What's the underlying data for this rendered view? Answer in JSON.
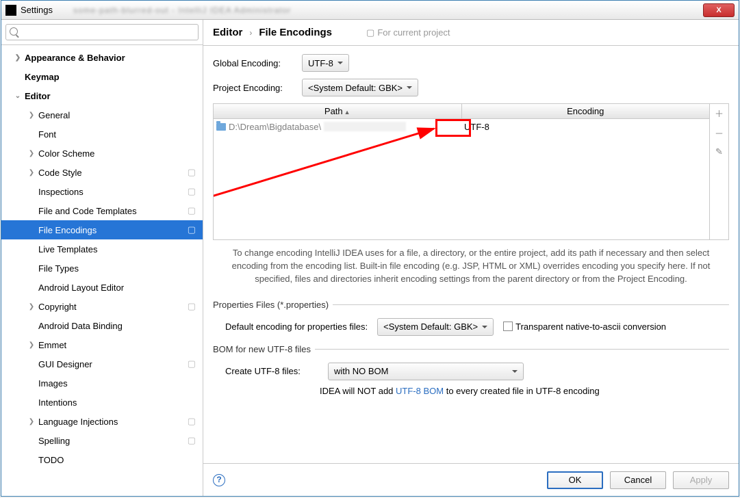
{
  "window": {
    "title": "Settings",
    "title_blur": "some-path-blurred-out  -  IntelliJ IDEA Administrator"
  },
  "search": {
    "placeholder": ""
  },
  "tree": [
    {
      "label": "Appearance & Behavior",
      "lvl": 0,
      "chev": ">",
      "bold": true
    },
    {
      "label": "Keymap",
      "lvl": 0,
      "chev": "",
      "bold": true
    },
    {
      "label": "Editor",
      "lvl": 0,
      "chev": "v",
      "bold": true
    },
    {
      "label": "General",
      "lvl": 1,
      "chev": ">"
    },
    {
      "label": "Font",
      "lvl": 1,
      "chev": ""
    },
    {
      "label": "Color Scheme",
      "lvl": 1,
      "chev": ">"
    },
    {
      "label": "Code Style",
      "lvl": 1,
      "chev": ">",
      "sep": true
    },
    {
      "label": "Inspections",
      "lvl": 1,
      "chev": "",
      "sep": true
    },
    {
      "label": "File and Code Templates",
      "lvl": 1,
      "chev": "",
      "sep": true
    },
    {
      "label": "File Encodings",
      "lvl": 1,
      "chev": "",
      "sep": true,
      "selected": true
    },
    {
      "label": "Live Templates",
      "lvl": 1,
      "chev": ""
    },
    {
      "label": "File Types",
      "lvl": 1,
      "chev": ""
    },
    {
      "label": "Android Layout Editor",
      "lvl": 1,
      "chev": ""
    },
    {
      "label": "Copyright",
      "lvl": 1,
      "chev": ">",
      "sep": true
    },
    {
      "label": "Android Data Binding",
      "lvl": 1,
      "chev": ""
    },
    {
      "label": "Emmet",
      "lvl": 1,
      "chev": ">"
    },
    {
      "label": "GUI Designer",
      "lvl": 1,
      "chev": "",
      "sep": true
    },
    {
      "label": "Images",
      "lvl": 1,
      "chev": ""
    },
    {
      "label": "Intentions",
      "lvl": 1,
      "chev": ""
    },
    {
      "label": "Language Injections",
      "lvl": 1,
      "chev": ">",
      "sep": true
    },
    {
      "label": "Spelling",
      "lvl": 1,
      "chev": "",
      "sep": true
    },
    {
      "label": "TODO",
      "lvl": 1,
      "chev": ""
    }
  ],
  "breadcrumb": {
    "a": "Editor",
    "sep": "›",
    "b": "File Encodings",
    "for_project": "For current project"
  },
  "form": {
    "global_label": "Global Encoding:",
    "global_value": "UTF-8",
    "project_label": "Project Encoding:",
    "project_value": "<System Default: GBK>"
  },
  "table": {
    "col_path": "Path",
    "col_enc": "Encoding",
    "row_path": "D:\\Dream\\Bigdatabase\\",
    "row_enc": "UTF-8"
  },
  "help_text": "To change encoding IntelliJ IDEA uses for a file, a directory, or the entire project, add its path if necessary and then select encoding from the encoding list. Built-in file encoding (e.g. JSP, HTML or XML) overrides encoding you specify here. If not specified, files and directories inherit encoding settings from the parent directory or from the Project Encoding.",
  "props_section": {
    "legend": "Properties Files (*.properties)",
    "default_label": "Default encoding for properties files:",
    "default_value": "<System Default: GBK>",
    "transparent_label": "Transparent native-to-ascii conversion"
  },
  "bom_section": {
    "legend": "BOM for new UTF-8 files",
    "create_label": "Create UTF-8 files:",
    "create_value": "with NO BOM",
    "note_a": "IDEA will NOT add ",
    "note_link": "UTF-8 BOM",
    "note_b": " to every created file in UTF-8 encoding"
  },
  "footer": {
    "ok": "OK",
    "cancel": "Cancel",
    "apply": "Apply"
  }
}
